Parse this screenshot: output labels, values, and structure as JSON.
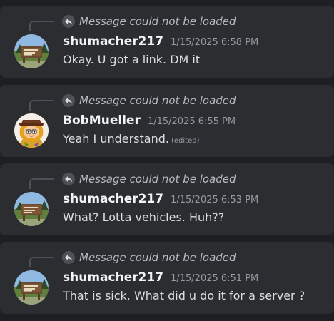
{
  "messages": [
    {
      "reply_text": "Message could not be loaded",
      "username": "shumacher217",
      "timestamp": "1/15/2025 6:58 PM",
      "content": "Okay. U got a link. DM it",
      "edited_label": "",
      "avatar_icon": "national-park-sign-avatar"
    },
    {
      "reply_text": "Message could not be loaded",
      "username": "BobMueller",
      "timestamp": "1/15/2025 6:55 PM",
      "content": "Yeah I understand.",
      "edited_label": "(edited)",
      "avatar_icon": "cartoon-character-avatar"
    },
    {
      "reply_text": "Message could not be loaded",
      "username": "shumacher217",
      "timestamp": "1/15/2025 6:53 PM",
      "content": "What? Lotta vehicles. Huh??",
      "edited_label": "",
      "avatar_icon": "national-park-sign-avatar"
    },
    {
      "reply_text": "Message could not be loaded",
      "username": "shumacher217",
      "timestamp": "1/15/2025 6:51 PM",
      "content": "That is sick. What did u do it for a server ?",
      "edited_label": "",
      "avatar_icon": "national-park-sign-avatar"
    }
  ],
  "colors": {
    "background": "#1e1f22",
    "card": "#2b2d31",
    "username": "#f2f3f5",
    "text": "#dbdee1",
    "muted": "#949ba4"
  }
}
